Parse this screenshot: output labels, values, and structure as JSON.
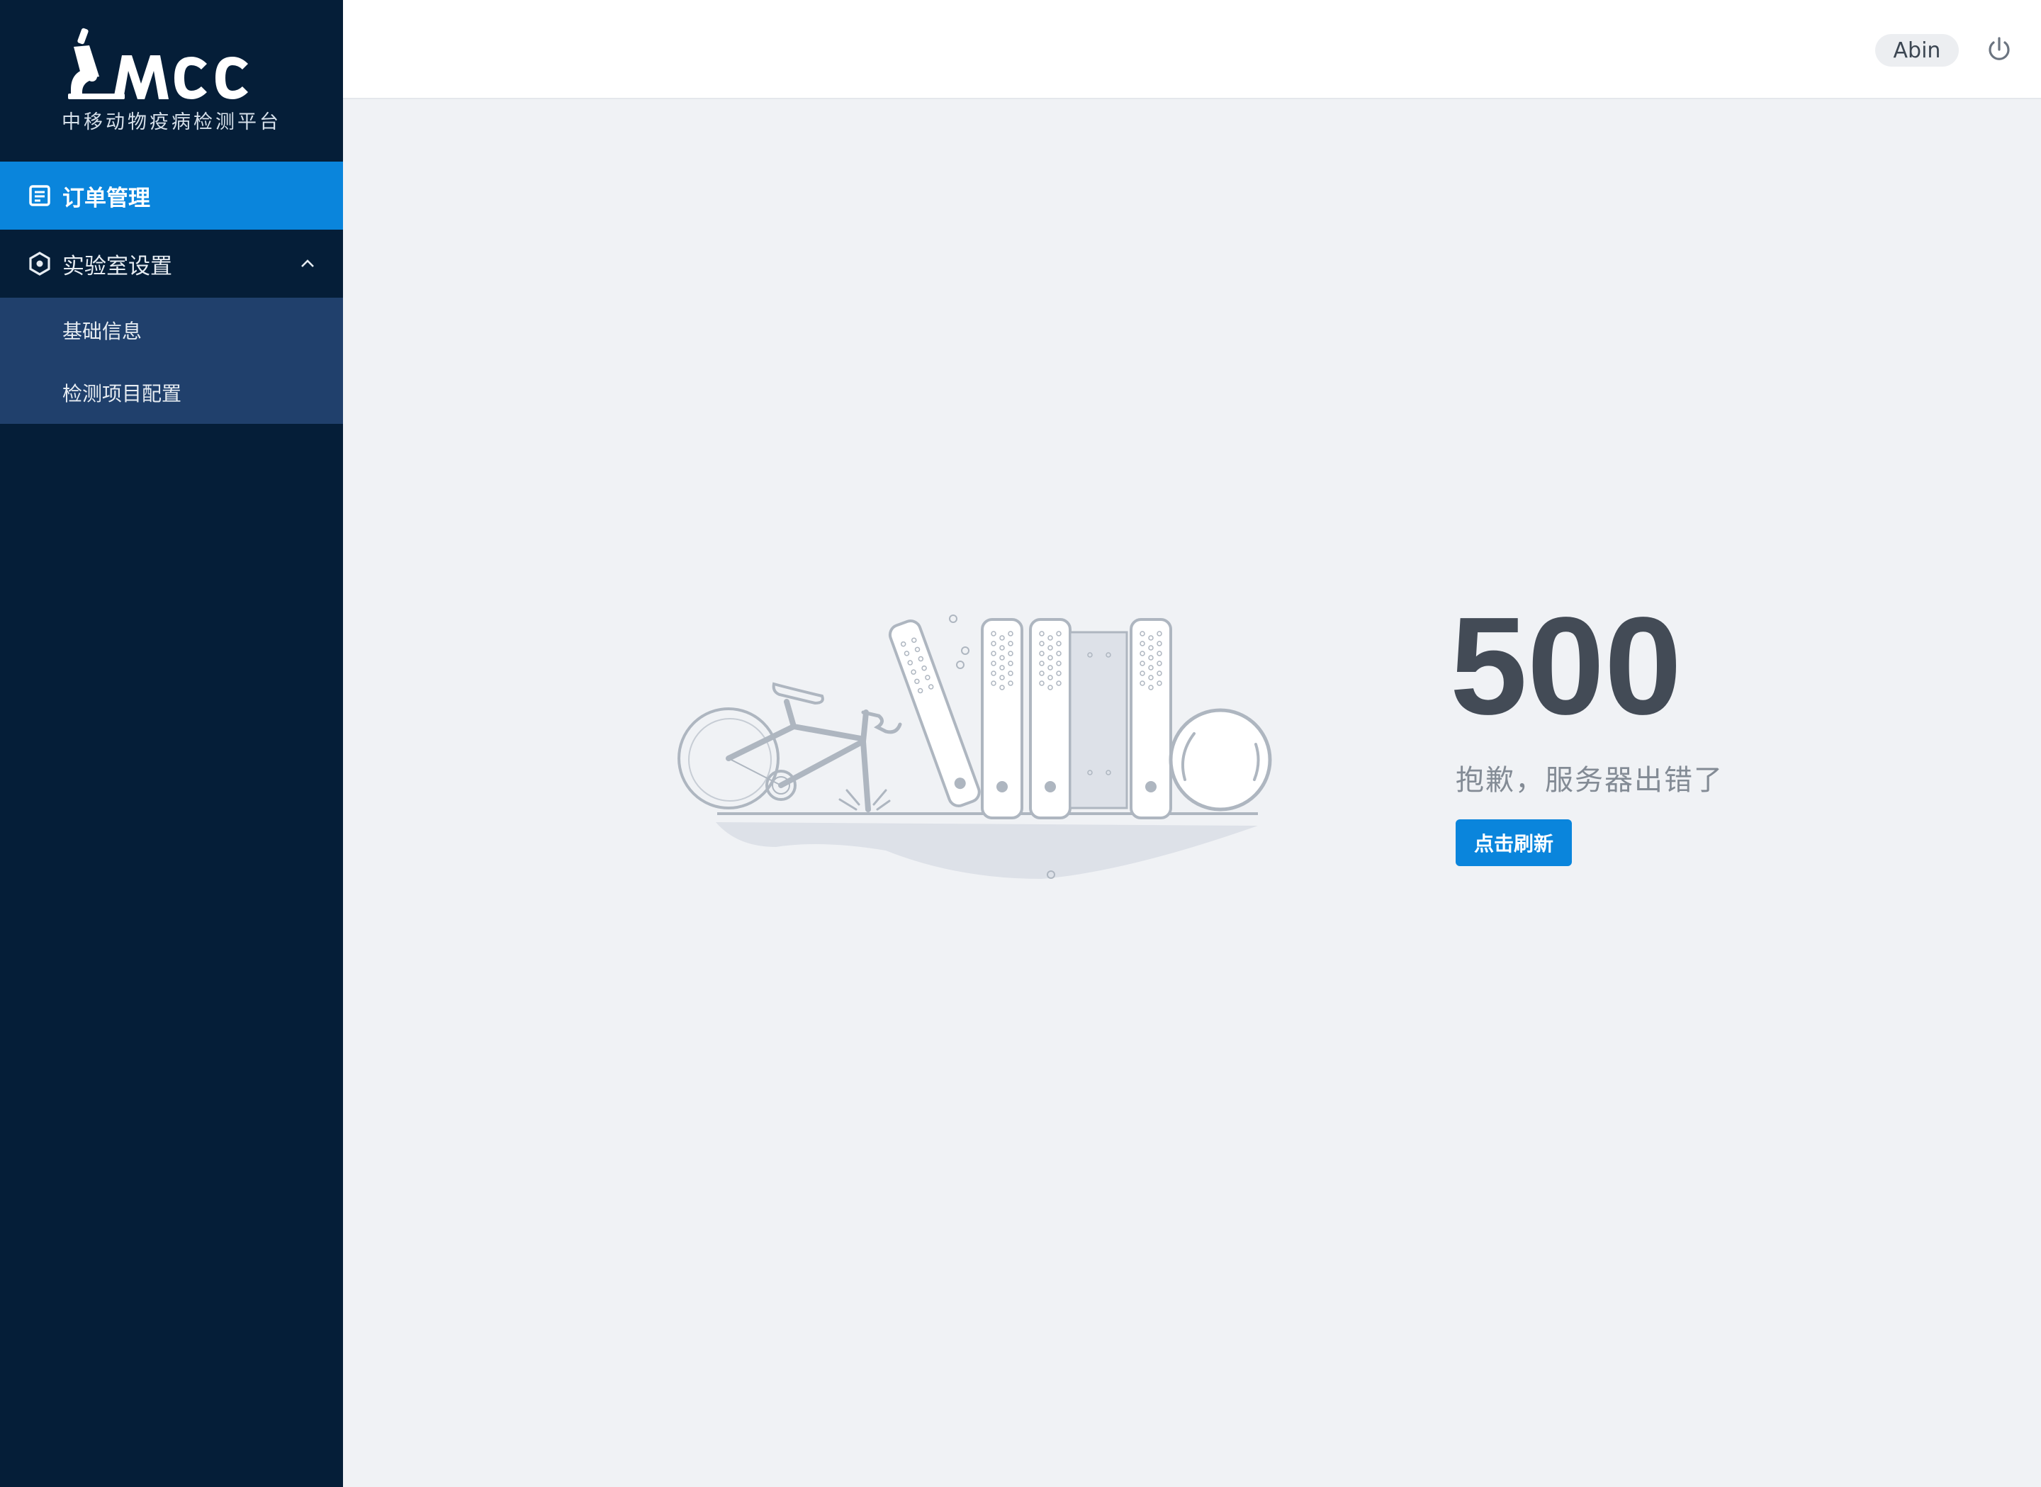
{
  "app": {
    "logo_text": "MCC",
    "subtitle": "中移动物疫病检测平台"
  },
  "sidebar": {
    "items": [
      {
        "label": "订单管理",
        "icon": "document-icon",
        "active": true
      },
      {
        "label": "实验室设置",
        "icon": "settings-hex-icon",
        "expanded": true,
        "children": [
          {
            "label": "基础信息"
          },
          {
            "label": "检测项目配置"
          }
        ]
      }
    ]
  },
  "header": {
    "username": "Abin",
    "power_icon": "power-icon"
  },
  "error": {
    "code": "500",
    "message": "抱歉，服务器出错了",
    "refresh_label": "点击刷新"
  },
  "colors": {
    "sidebar_bg": "#051e38",
    "submenu_bg": "#20406c",
    "accent": "#0a85dc",
    "page_bg": "#f0f2f5"
  }
}
